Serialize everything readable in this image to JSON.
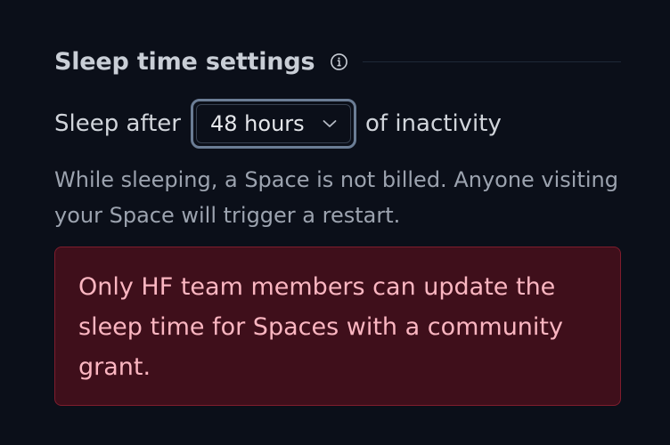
{
  "section": {
    "title": "Sleep time settings",
    "info_icon": "info-circle-icon"
  },
  "sleep": {
    "prefix": "Sleep after",
    "selected_value": "48 hours",
    "dropdown_icon": "chevron-down-icon",
    "suffix": "of inactivity",
    "help_text": "While sleeping, a Space is not billed. Anyone visiting your Space will trigger a restart."
  },
  "alert": {
    "message": "Only HF team members can update the sleep time for Spaces with a community grant."
  },
  "colors": {
    "background": "#0b0f19",
    "alert_background": "#3f0f1b",
    "alert_border": "#7f1d2d",
    "alert_text": "#fbb6c1",
    "select_focus_ring": "#6b7d95"
  }
}
